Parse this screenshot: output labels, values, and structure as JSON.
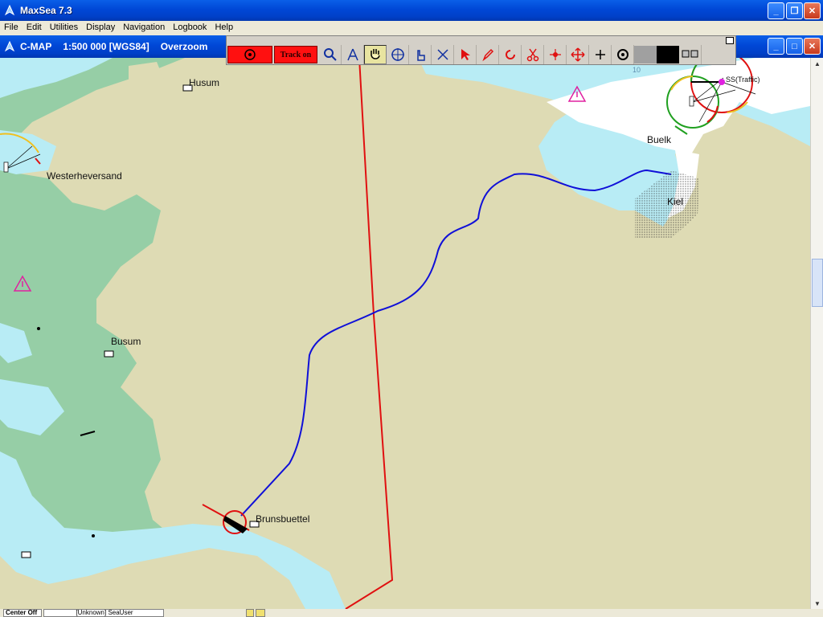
{
  "window": {
    "title": "MaxSea 7.3"
  },
  "menu": [
    "File",
    "Edit",
    "Utilities",
    "Display",
    "Navigation",
    "Logbook",
    "Help"
  ],
  "child": {
    "chart": "C-MAP",
    "scale": "1:500 000 [WGS84]",
    "mode": "Overzoom"
  },
  "toolbar": {
    "track_label": "Track on"
  },
  "map": {
    "places": [
      {
        "id": "husum",
        "name": "Husum"
      },
      {
        "id": "westerheversand",
        "name": "Westerheversand"
      },
      {
        "id": "busum",
        "name": "Busum"
      },
      {
        "id": "brunsbuettel",
        "name": "Brunsbuettel"
      },
      {
        "id": "buelk",
        "name": "Buelk"
      },
      {
        "id": "kiel",
        "name": "Kiel"
      }
    ],
    "traffic_label": "SS(Traffic)",
    "depth_label": "10",
    "colors": {
      "land": "#DEDBB4",
      "water": "#B8ECF5",
      "shallow": "#96CEA6",
      "route": "#E01010",
      "track": "#1010D8"
    }
  },
  "status": {
    "left": "Center Off",
    "user": "[Unknown] SeaUser"
  }
}
